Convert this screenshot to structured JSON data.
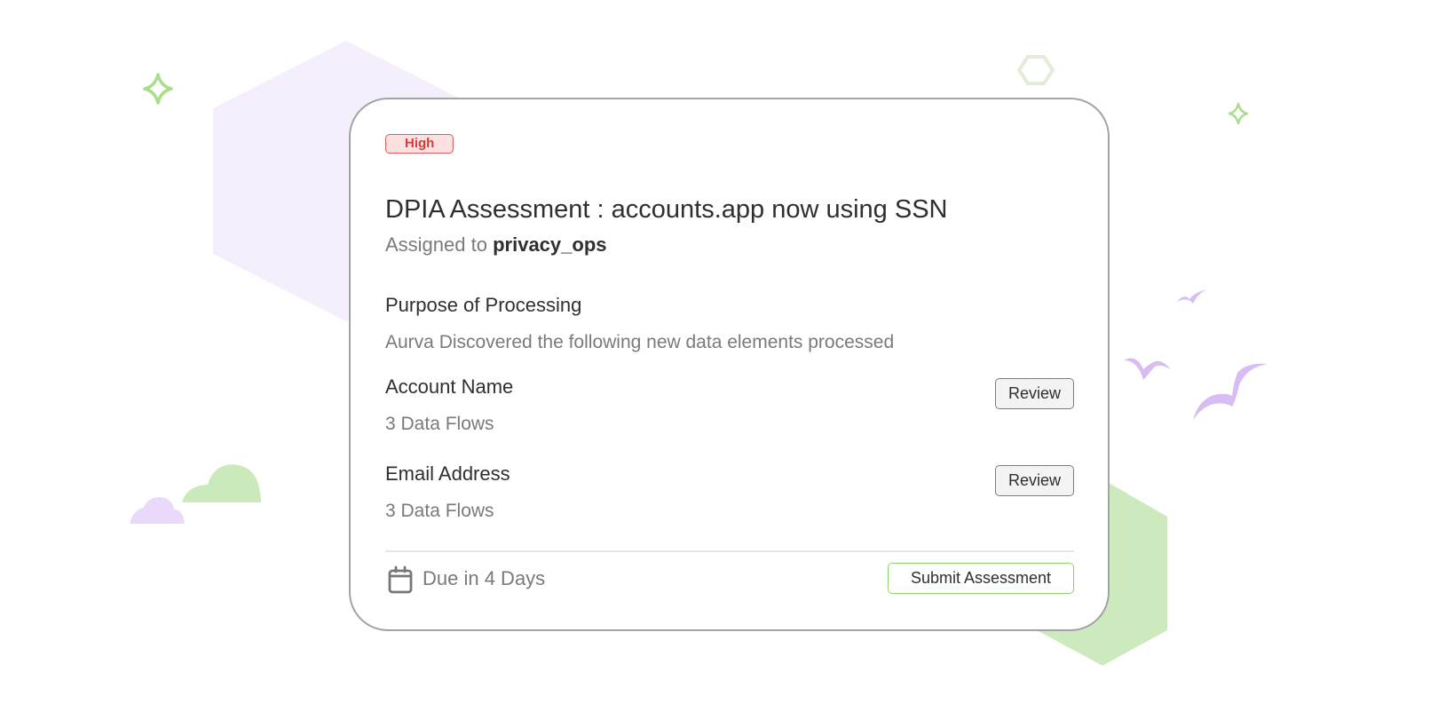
{
  "card": {
    "priority_badge": "High",
    "title": "DPIA Assessment : accounts.app now using SSN",
    "assigned_prefix": "Assigned to",
    "assigned_owner": "privacy_ops",
    "purpose_label": "Purpose of Processing",
    "purpose_description": "Aurva Discovered the following new data elements processed",
    "data_elements": [
      {
        "name": "Account Name",
        "flows": "3 Data Flows",
        "action": "Review"
      },
      {
        "name": "Email Address",
        "flows": "3 Data Flows",
        "action": "Review"
      }
    ],
    "due_text": "Due in 4 Days",
    "submit_label": "Submit Assessment"
  },
  "icons": {
    "due": "calendar-icon"
  },
  "colors": {
    "badge_text": "#d63b3b",
    "badge_bg": "#fde0e0",
    "submit_border": "#8bd46a",
    "decor_purple": "#f3ecfc",
    "decor_green": "#cbeabb"
  }
}
